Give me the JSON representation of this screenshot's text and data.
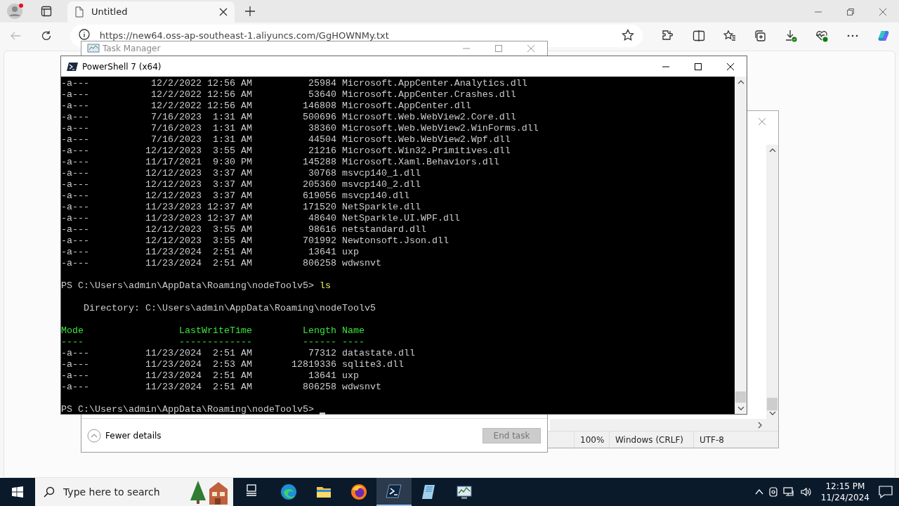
{
  "browser": {
    "tab": {
      "title": "Untitled"
    },
    "address": {
      "url": "https://new64.oss-ap-southeast-1.aliyuncs.com/GgHOWNMy.txt"
    }
  },
  "notepad": {
    "status_bar": [
      "100%",
      "Windows (CRLF)",
      "UTF-8"
    ]
  },
  "task_manager": {
    "title": "Task Manager",
    "details_toggle": "Fewer details",
    "end_task": {
      "label": "End task",
      "disabled": true
    }
  },
  "powershell": {
    "title": "PowerShell 7 (x64)",
    "lines": [
      {
        "kind": "output",
        "text": "-a---           12/2/2022 12:56 AM          25984 Microsoft.AppCenter.Analytics.dll"
      },
      {
        "kind": "output",
        "text": "-a---           12/2/2022 12:56 AM          53640 Microsoft.AppCenter.Crashes.dll"
      },
      {
        "kind": "output",
        "text": "-a---           12/2/2022 12:56 AM         146808 Microsoft.AppCenter.dll"
      },
      {
        "kind": "output",
        "text": "-a---           7/16/2023  1:31 AM         500696 Microsoft.Web.WebView2.Core.dll"
      },
      {
        "kind": "output",
        "text": "-a---           7/16/2023  1:31 AM          38360 Microsoft.Web.WebView2.WinForms.dll"
      },
      {
        "kind": "output",
        "text": "-a---           7/16/2023  1:31 AM          44504 Microsoft.Web.WebView2.Wpf.dll"
      },
      {
        "kind": "output",
        "text": "-a---          12/12/2023  3:55 AM          21216 Microsoft.Win32.Primitives.dll"
      },
      {
        "kind": "output",
        "text": "-a---          11/17/2021  9:30 PM         145288 Microsoft.Xaml.Behaviors.dll"
      },
      {
        "kind": "output",
        "text": "-a---          12/12/2023  3:37 AM          30768 msvcp140_1.dll"
      },
      {
        "kind": "output",
        "text": "-a---          12/12/2023  3:37 AM         205360 msvcp140_2.dll"
      },
      {
        "kind": "output",
        "text": "-a---          12/12/2023  3:37 AM         619056 msvcp140.dll"
      },
      {
        "kind": "output",
        "text": "-a---          11/23/2023 12:37 AM         171520 NetSparkle.dll"
      },
      {
        "kind": "output",
        "text": "-a---          11/23/2023 12:37 AM          48640 NetSparkle.UI.WPF.dll"
      },
      {
        "kind": "output",
        "text": "-a---          12/12/2023  3:55 AM          98616 netstandard.dll"
      },
      {
        "kind": "output",
        "text": "-a---          12/12/2023  3:55 AM         701992 Newtonsoft.Json.dll"
      },
      {
        "kind": "output",
        "text": "-a---          11/23/2024  2:51 AM          13641 uxp"
      },
      {
        "kind": "output",
        "text": "-a---          11/23/2024  2:51 AM         806258 wdwsnvt"
      },
      {
        "kind": "blank"
      },
      {
        "kind": "prompt",
        "text": "PS C:\\Users\\admin\\AppData\\Roaming\\nodeToolv5>",
        "command": "ls"
      },
      {
        "kind": "blank"
      },
      {
        "kind": "output",
        "text": "    Directory: C:\\Users\\admin\\AppData\\Roaming\\nodeToolv5"
      },
      {
        "kind": "blank"
      },
      {
        "kind": "header",
        "text": "Mode                 LastWriteTime         Length Name"
      },
      {
        "kind": "header",
        "text": "----                 -------------         ------ ----"
      },
      {
        "kind": "output",
        "text": "-a---          11/23/2024  2:51 AM          77312 datastate.dll"
      },
      {
        "kind": "output",
        "text": "-a---          11/23/2024  2:53 AM       12819336 sqlite3.dll"
      },
      {
        "kind": "output",
        "text": "-a---          11/23/2024  2:51 AM          13641 uxp"
      },
      {
        "kind": "output",
        "text": "-a---          11/23/2024  2:51 AM         806258 wdwsnvt"
      },
      {
        "kind": "blank"
      },
      {
        "kind": "prompt",
        "text": "PS C:\\Users\\admin\\AppData\\Roaming\\nodeToolv5>",
        "cursor": true
      }
    ]
  },
  "taskbar": {
    "search": {
      "placeholder": "Type here to search"
    },
    "apps": [
      {
        "kind": "taskview",
        "selected": false
      },
      {
        "kind": "edge",
        "selected": false
      },
      {
        "kind": "explorer",
        "selected": false
      },
      {
        "kind": "firefox",
        "selected": false
      },
      {
        "kind": "powershell",
        "selected": true
      },
      {
        "kind": "notepad",
        "selected": false
      },
      {
        "kind": "taskmanager",
        "selected": false
      }
    ],
    "clock": {
      "time": "12:15 PM",
      "date": "11/24/2024"
    }
  }
}
